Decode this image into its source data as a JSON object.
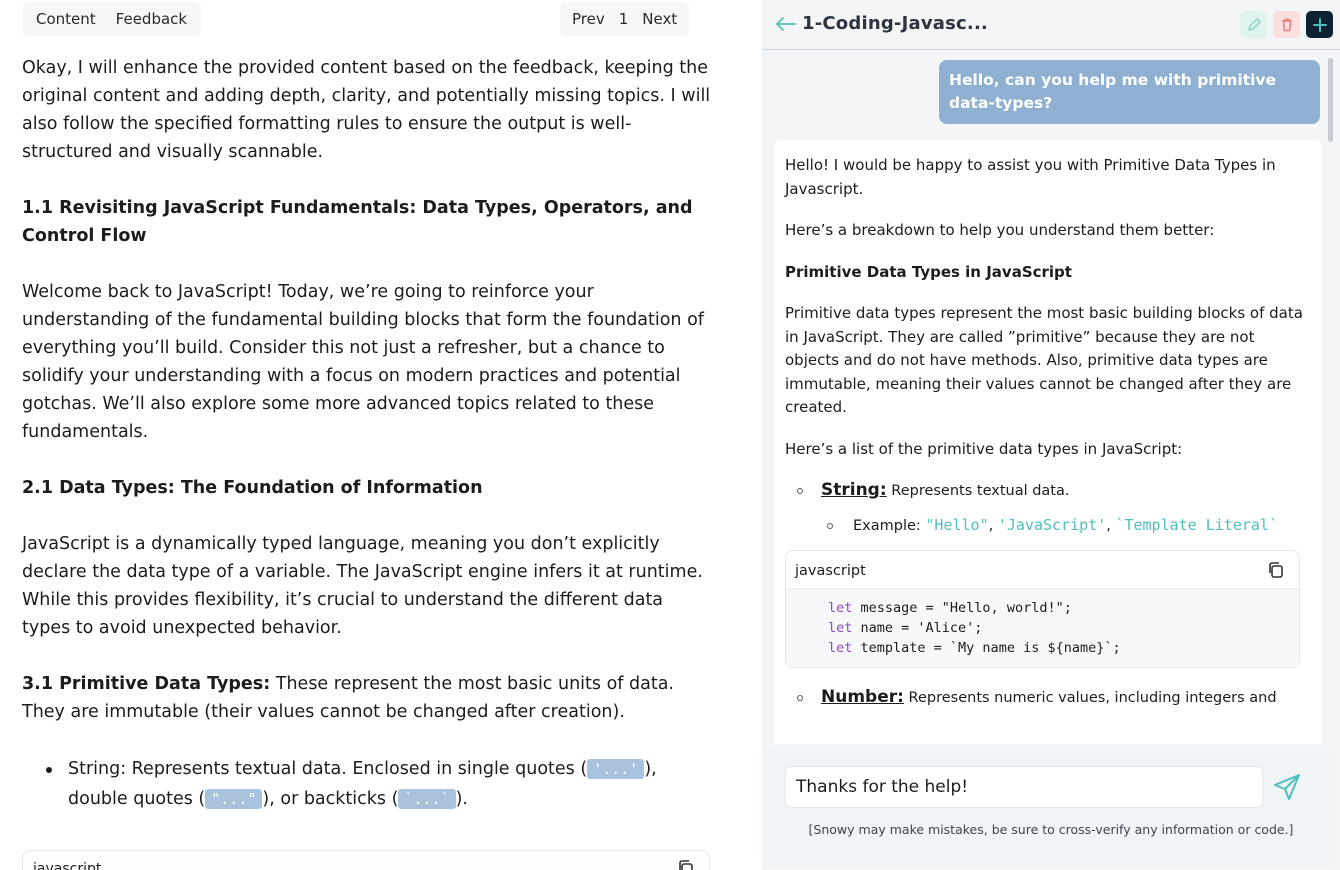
{
  "left": {
    "tabs": [
      "Content",
      "Feedback"
    ],
    "pager": {
      "prev": "Prev",
      "page": "1",
      "next": "Next"
    },
    "intro": "Okay, I will enhance the provided content based on the feedback, keeping the original content and adding depth, clarity, and potentially missing topics. I will also follow the specified formatting rules to ensure the output is well-structured and visually scannable.",
    "heading1": "1.1 Revisiting JavaScript Fundamentals: Data Types, Operators, and Control Flow",
    "welcome": "Welcome back to JavaScript! Today, we’re going to reinforce your understanding of the fundamental building blocks that form the foundation of everything you’ll build. Consider this not just a refresher, but a chance to solidify your understanding with a focus on modern practices and potential gotchas. We’ll also explore some more advanced topics related to these fundamentals.",
    "heading2": "2.1 Data Types: The Foundation of Information",
    "dynamic": "JavaScript is a dynamically typed language, meaning you don’t explicitly declare the data type of a variable. The JavaScript engine infers it at runtime. While this provides flexibility, it’s crucial to understand the different data types to avoid unexpected behavior.",
    "primitive_label": "3.1 Primitive Data Types:",
    "primitive_text": " These represent the most basic units of data. They are immutable (their values cannot be changed after creation).",
    "bullet": {
      "lead": "String: Represents textual data. Enclosed in single quotes (",
      "code1": "'...'",
      "mid1": "), double quotes (",
      "code2": "\"...\"",
      "mid2": "), or backticks (",
      "code3": "`...`",
      "tail": ")."
    },
    "codeblock_lang": "javascript"
  },
  "chat": {
    "title": "1-Coding-Javasc...",
    "user_message": "Hello, can you help me with primitive data-types?",
    "bot": {
      "p1": "Hello! I would be happy to assist you with Primitive Data Types in Javascript.",
      "p2": "Here’s a breakdown to help you understand them better:",
      "p3": "Primitive Data Types in JavaScript",
      "p4": "Primitive data types represent the most basic building blocks of data in JavaScript. They are called ”primitive” because they are not objects and do not have methods. Also, primitive data types are immutable, meaning their values cannot be changed after they are created.",
      "p5": "Here’s a list of the primitive data types in JavaScript:",
      "string_term": "String:",
      "string_desc": " Represents textual data.",
      "example_label": "Example: ",
      "example_code1": "\"Hello\"",
      "example_code2": "'JavaScript'",
      "example_code3": "`Template Literal`",
      "code_lang": "javascript",
      "code_lines": [
        {
          "kw": "let",
          "rest": " message = \"Hello, world!\";"
        },
        {
          "kw": "let",
          "rest": " name = 'Alice';"
        },
        {
          "kw": "let",
          "rest": " template = `My name is ${name}`;"
        }
      ],
      "number_term": "Number:",
      "number_desc": " Represents numeric values, including integers and"
    },
    "input_value": "Thanks for the help!",
    "disclaimer": "[Snowy may make mistakes, be sure to cross-verify any information or code.]"
  },
  "icons": {
    "back": "arrow-left-icon",
    "edit": "pencil-icon",
    "delete": "trash-icon",
    "add": "plus-icon",
    "copy": "copy-icon",
    "send": "send-icon"
  },
  "colors": {
    "user_bubble": "#8fb0d0",
    "teal_code": "#4fbfbf",
    "header_add": "#0f2233",
    "send": "#4fbfbf"
  }
}
